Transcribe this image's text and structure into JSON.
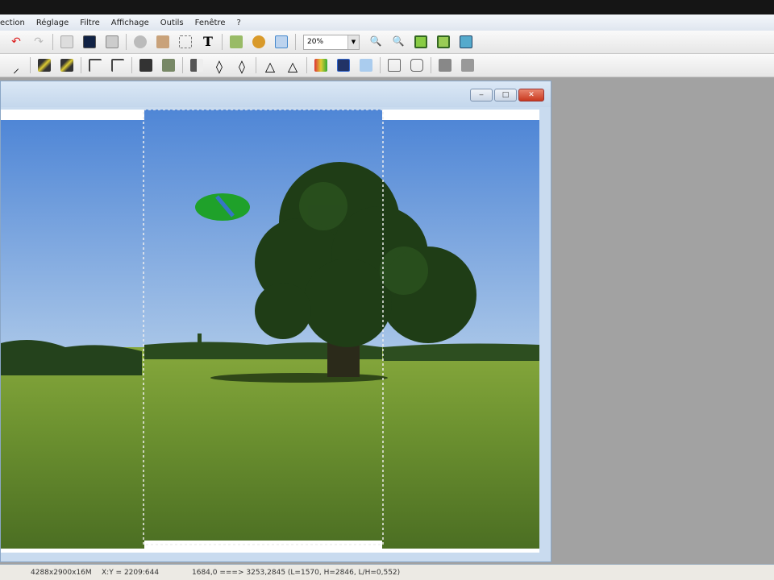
{
  "menu": [
    "ection",
    "Réglage",
    "Filtre",
    "Affichage",
    "Outils",
    "Fenêtre",
    "?"
  ],
  "toolbar1": {
    "zoom_value": "20%",
    "icons": [
      "undo-icon",
      "redo-icon",
      "copy-icon",
      "paste-icon",
      "page-icon",
      "clone-icon",
      "stamp-icon",
      "crop-icon",
      "text-icon",
      "tree-icon",
      "hand-icon",
      "window-icon",
      "zoom-in-icon",
      "zoom-out-icon",
      "fit-icon",
      "fit-all-icon",
      "monitor-icon"
    ]
  },
  "toolbar2": {
    "icons": [
      "pick-icon",
      "pick-black-icon",
      "pick-white-icon",
      "corner-icon",
      "corner2-icon",
      "grid-icon",
      "grid2-icon",
      "contrast-icon",
      "drop-icon",
      "drop2-icon",
      "triangle-icon",
      "triangle2-icon",
      "palette-icon",
      "color-icon",
      "layers-icon",
      "compare-icon",
      "print-icon",
      "tool1-icon",
      "tool2-icon"
    ]
  },
  "window": {
    "min": "‒",
    "max": "□",
    "close": "✕"
  },
  "status": {
    "size": "4288x2900x16M",
    "xy": "X:Y = 2209:644",
    "selection": "1684,0 ===> 3253,2845 (L=1570, H=2846, L/H=0,552)"
  },
  "colors": {
    "accent": "#e8563f",
    "selection": "#ffffff"
  }
}
